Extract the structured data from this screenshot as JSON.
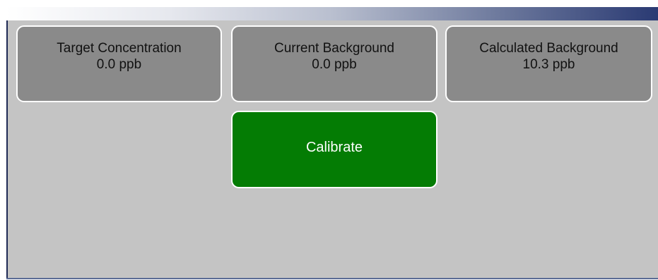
{
  "tiles": {
    "target_concentration": {
      "label": "Target Concentration",
      "value": "0.0 ppb"
    },
    "current_background": {
      "label": "Current Background",
      "value": "0.0 ppb"
    },
    "calculated_background": {
      "label": "Calculated Background",
      "value": "10.3 ppb"
    }
  },
  "actions": {
    "calibrate_label": "Calibrate"
  },
  "colors": {
    "panel_background": "#c4c4c4",
    "tile_background": "#8a8a8a",
    "calibrate_background": "#047c04",
    "title_bar_end": "#2a3a73"
  }
}
